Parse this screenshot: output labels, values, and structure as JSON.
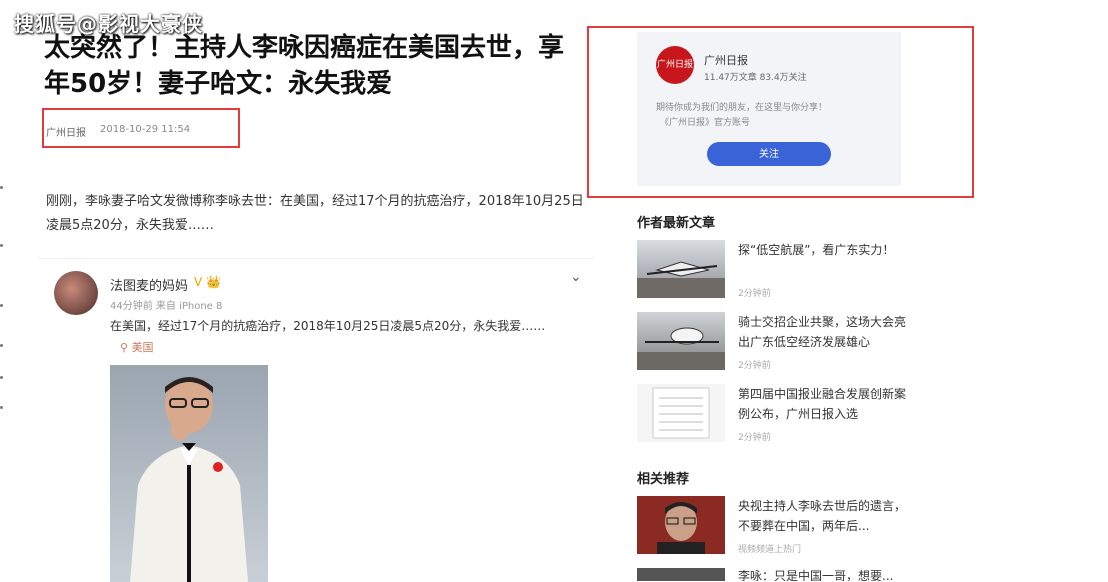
{
  "watermark": "搜狐号@影视大豪侠",
  "article": {
    "title": "太突然了！主持人李咏因癌症在美国去世，享年50岁！妻子哈文：永失我爱",
    "source": "广州日报",
    "time": "2018-10-29 11:54",
    "paragraph": "刚刚，李咏妻子哈文发微博称李咏去世：在美国，经过17个月的抗癌治疗，2018年10月25日凌晨5点20分，永失我爱……"
  },
  "weibo": {
    "name": "法图麦的妈妈",
    "vip": "V 👑",
    "sub": "44分钟前 来自 iPhone 8",
    "text": "在美国，经过17个月的抗癌治疗，2018年10月25日凌晨5点20分，永失我爱……",
    "location": "美国"
  },
  "follow_card": {
    "name": "广州日报",
    "stats": "11.47万文章 83.4万关注",
    "line1": "期待你成为我们的朋友，在这里与你分享！",
    "line2": "《广州日报》官方账号",
    "button": "关注",
    "logo_text": "广州日报"
  },
  "side": {
    "latest_heading": "作者最新文章",
    "latest": [
      {
        "title": "探“低空航展”，看广东实力！",
        "time": "2分钟前"
      },
      {
        "title": "骑士交招企业共聚，这场大会亮出广东低空经济发展雄心",
        "time": "2分钟前"
      },
      {
        "title": "第四届中国报业融合发展创新案例公布，广州日报入选",
        "time": "2分钟前"
      }
    ],
    "related_heading": "相关推荐",
    "related": [
      {
        "title": "央视主持人李咏去世后的遗言，不要葬在中国，两年后...",
        "time": "视频频道上热门"
      },
      {
        "title": "李咏：只是中国一哥，想要...",
        "time": ""
      }
    ]
  },
  "colors": {
    "highlight": "#e23b3b",
    "brand": "#c8161d",
    "button": "#3a63d8"
  }
}
